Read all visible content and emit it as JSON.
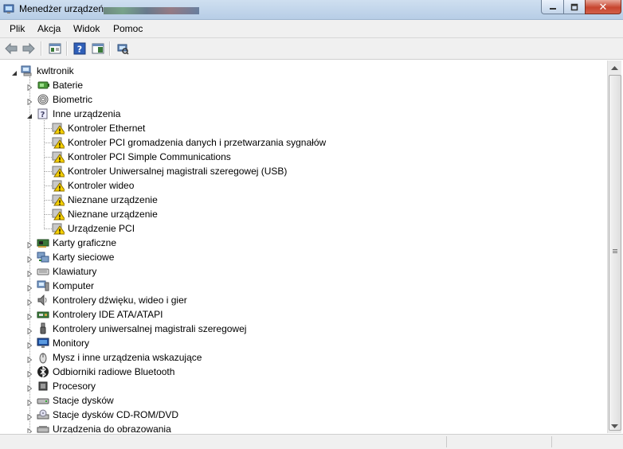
{
  "window": {
    "title": "Menedżer urządzeń"
  },
  "menu": [
    "Plik",
    "Akcja",
    "Widok",
    "Pomoc"
  ],
  "toolbar": {
    "buttons": [
      "back-icon",
      "forward-icon",
      "properties-icon",
      "help-icon",
      "view-icon",
      "scan-hardware-icon"
    ]
  },
  "tree": {
    "root": "kwltronik",
    "categories": [
      {
        "label": "Baterie",
        "icon": "battery-icon",
        "expanded": false
      },
      {
        "label": "Biometric",
        "icon": "fingerprint-icon",
        "expanded": false
      },
      {
        "label": "Inne urządzenia",
        "icon": "other-devices-icon",
        "expanded": true,
        "children": [
          "Kontroler Ethernet",
          "Kontroler PCI gromadzenia danych i przetwarzania sygnałów",
          "Kontroler PCI Simple Communications",
          "Kontroler Uniwersalnej magistrali szeregowej (USB)",
          "Kontroler wideo",
          "Nieznane urządzenie",
          "Nieznane urządzenie",
          "Urządzenie PCI"
        ]
      },
      {
        "label": "Karty graficzne",
        "icon": "display-adapter-icon",
        "expanded": false
      },
      {
        "label": "Karty sieciowe",
        "icon": "network-adapter-icon",
        "expanded": false
      },
      {
        "label": "Klawiatury",
        "icon": "keyboard-icon",
        "expanded": false
      },
      {
        "label": "Komputer",
        "icon": "computer-icon",
        "expanded": false
      },
      {
        "label": "Kontrolery dźwięku, wideo i gier",
        "icon": "speaker-icon",
        "expanded": false
      },
      {
        "label": "Kontrolery IDE ATA/ATAPI",
        "icon": "ide-controller-icon",
        "expanded": false
      },
      {
        "label": "Kontrolery uniwersalnej magistrali szeregowej",
        "icon": "usb-icon",
        "expanded": false
      },
      {
        "label": "Monitory",
        "icon": "monitor-icon",
        "expanded": false
      },
      {
        "label": "Mysz i inne urządzenia wskazujące",
        "icon": "mouse-icon",
        "expanded": false
      },
      {
        "label": "Odbiorniki radiowe Bluetooth",
        "icon": "bluetooth-icon",
        "expanded": false
      },
      {
        "label": "Procesory",
        "icon": "processor-icon",
        "expanded": false
      },
      {
        "label": "Stacje dysków",
        "icon": "disk-drive-icon",
        "expanded": false
      },
      {
        "label": "Stacje dysków CD-ROM/DVD",
        "icon": "cdrom-icon",
        "expanded": false
      },
      {
        "label": "Urządzenia do obrazowania",
        "icon": "imaging-device-icon",
        "expanded": false
      }
    ]
  },
  "colors": {
    "titlebar": "#c5d7ec",
    "warning": "#f5d000",
    "close": "#c7452f"
  }
}
